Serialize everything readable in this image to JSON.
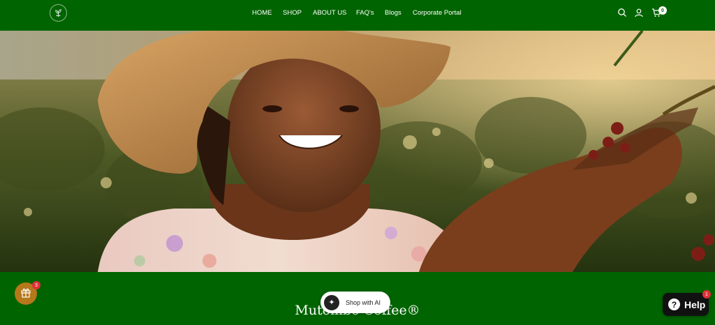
{
  "nav": {
    "items": [
      "HOME",
      "SHOP",
      "ABOUT US",
      "FAQ's",
      "Blogs",
      "Corporate Portal"
    ]
  },
  "header": {
    "cart_count": "0"
  },
  "icons": {
    "logo": "coffee-plant-logo-icon",
    "search": "search-icon",
    "account": "user-icon",
    "cart": "cart-icon",
    "gift": "gift-icon",
    "ai": "sparkle-icon",
    "help": "help-icon"
  },
  "main": {
    "brand_heading": "Mutombo Coffee®"
  },
  "widgets": {
    "rewards_count": "3",
    "shop_ai_label": "Shop with AI",
    "help_label": "Help",
    "help_count": "1"
  },
  "colors": {
    "brand_green": "#006400",
    "rewards_gold": "#b5781a",
    "badge_red": "#e0303a"
  }
}
